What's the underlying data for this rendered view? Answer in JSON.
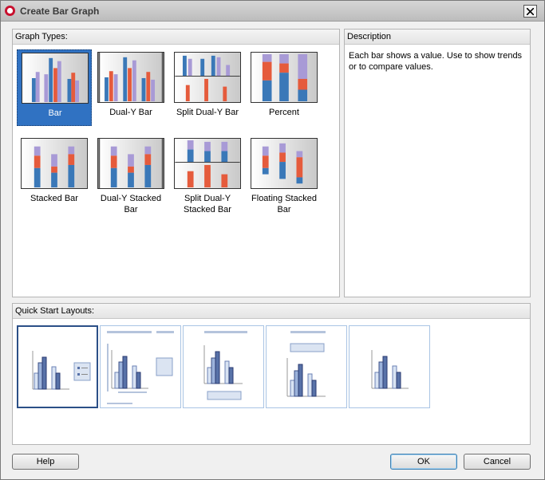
{
  "window": {
    "title": "Create Bar Graph"
  },
  "graph_types": {
    "header": "Graph Types:",
    "items": [
      {
        "label": "Bar",
        "selected": true
      },
      {
        "label": "Dual-Y Bar",
        "selected": false
      },
      {
        "label": "Split Dual-Y Bar",
        "selected": false
      },
      {
        "label": "Percent",
        "selected": false
      },
      {
        "label": "Stacked Bar",
        "selected": false
      },
      {
        "label": "Dual-Y Stacked Bar",
        "selected": false
      },
      {
        "label": "Split Dual-Y Stacked Bar",
        "selected": false
      },
      {
        "label": "Floating Stacked Bar",
        "selected": false
      }
    ]
  },
  "description": {
    "header": "Description",
    "text": "Each bar shows a value. Use to show trends or to compare values."
  },
  "quick_start": {
    "header": "Quick Start Layouts:",
    "selected_index": 0
  },
  "buttons": {
    "help": "Help",
    "ok": "OK",
    "cancel": "Cancel"
  },
  "colors": {
    "blue_bar": "#3a78b8",
    "red_bar": "#e55b3c",
    "purple_bar": "#a89ad6",
    "selection": "#3072c2"
  }
}
